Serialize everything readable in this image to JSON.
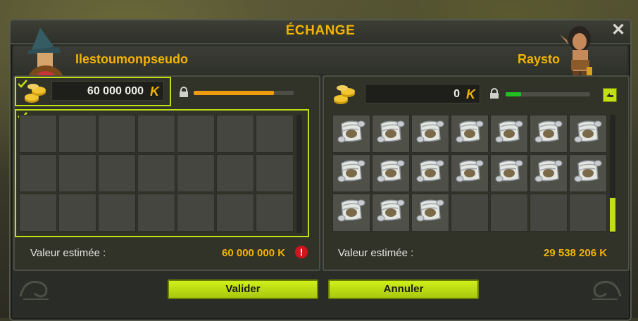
{
  "window": {
    "title": "ÉCHANGE"
  },
  "players": {
    "left_name": "Ilestoumonpseudo",
    "right_name": "Raysto"
  },
  "left_panel": {
    "kamas_value": "60 000 000",
    "kamas_symbol": "K",
    "progress": 0.8,
    "progress_color": "#f09a10",
    "estimate_label": "Valeur estimée :",
    "estimate_value": "60 000 000 K",
    "alert_symbol": "!",
    "grid_rows": 3,
    "grid_cols": 7,
    "items": []
  },
  "right_panel": {
    "kamas_value": "0",
    "kamas_symbol": "K",
    "progress": 0.18,
    "progress_color": "#22c020",
    "estimate_label": "Valeur estimée :",
    "estimate_value": "29 538 206 K",
    "grid_rows": 3,
    "grid_cols": 7,
    "filled_count": 17,
    "item_icon": "scroll-icon"
  },
  "buttons": {
    "validate": "Valider",
    "cancel": "Annuler"
  },
  "colors": {
    "accent": "#f2b400",
    "button": "#c0df15",
    "selection": "#c0df15",
    "alert": "#d3141c"
  }
}
